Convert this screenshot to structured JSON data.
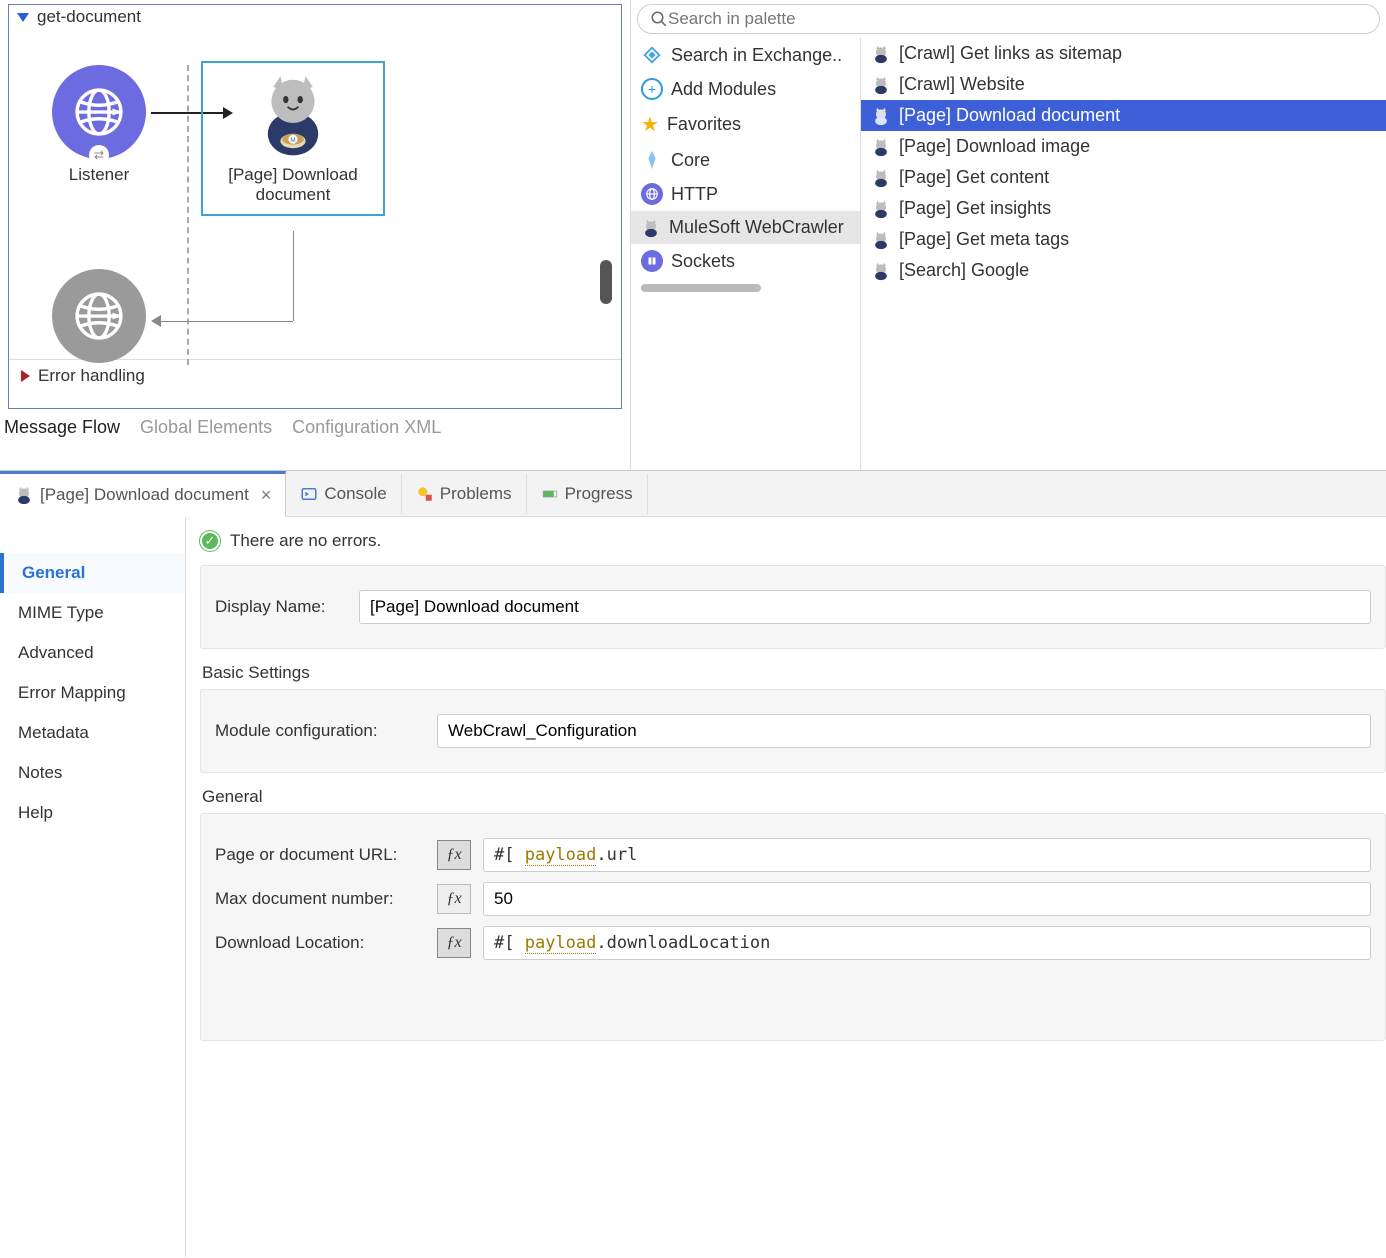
{
  "flow": {
    "name": "get-document",
    "listener_label": "Listener",
    "download_label": "[Page] Download document",
    "error_section": "Error handling"
  },
  "view_tabs": [
    "Message Flow",
    "Global Elements",
    "Configuration XML"
  ],
  "palette": {
    "search_placeholder": "Search in palette",
    "categories": [
      {
        "label": "Search in Exchange..",
        "type": "exchange"
      },
      {
        "label": "Add Modules",
        "type": "add"
      },
      {
        "label": "Favorites",
        "type": "fav"
      },
      {
        "label": "Core",
        "type": "core"
      },
      {
        "label": "HTTP",
        "type": "http"
      },
      {
        "label": "MuleSoft WebCrawler",
        "type": "crawler",
        "selected": true
      },
      {
        "label": "Sockets",
        "type": "sockets"
      }
    ],
    "operations": [
      {
        "label": "[Crawl] Get links as sitemap"
      },
      {
        "label": "[Crawl] Website"
      },
      {
        "label": "[Page] Download document",
        "selected": true
      },
      {
        "label": "[Page] Download image"
      },
      {
        "label": "[Page] Get content"
      },
      {
        "label": "[Page] Get insights"
      },
      {
        "label": "[Page] Get meta tags"
      },
      {
        "label": "[Search] Google"
      }
    ]
  },
  "bottom_tabs": {
    "active": "[Page] Download document",
    "others": [
      "Console",
      "Problems",
      "Progress"
    ]
  },
  "prop_nav": [
    "General",
    "MIME Type",
    "Advanced",
    "Error Mapping",
    "Metadata",
    "Notes",
    "Help"
  ],
  "status": "There are no errors.",
  "form": {
    "display_name_label": "Display Name:",
    "display_name_value": "[Page] Download document",
    "basic_settings": "Basic Settings",
    "module_config_label": "Module configuration:",
    "module_config_value": "WebCrawl_Configuration",
    "general_label": "General",
    "url_label": "Page or document URL:",
    "url_value_prefix": "#[ ",
    "url_value_kw": "payload",
    "url_value_suffix": ".url",
    "max_label": "Max document number:",
    "max_value": "50",
    "download_label": "Download Location:",
    "download_value_prefix": "#[ ",
    "download_value_kw": "payload",
    "download_value_suffix": ".downloadLocation"
  }
}
